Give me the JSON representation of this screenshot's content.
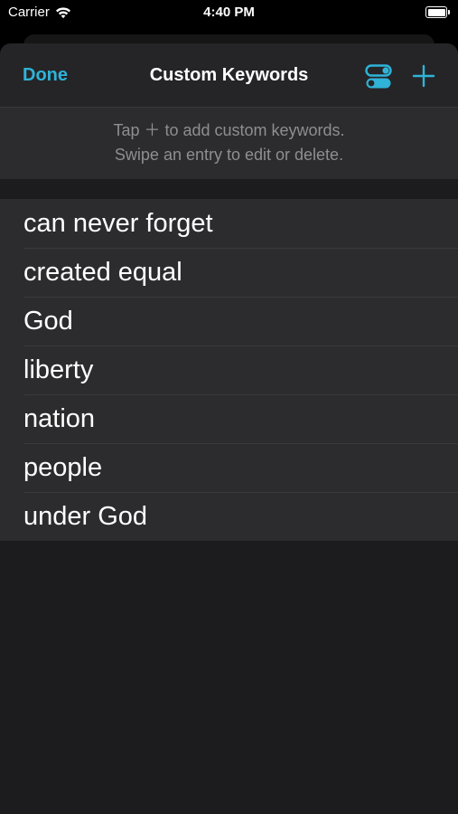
{
  "status_bar": {
    "carrier": "Carrier",
    "time": "4:40 PM"
  },
  "nav": {
    "done_label": "Done",
    "title": "Custom Keywords",
    "accent_color": "#2fb3d8"
  },
  "hint": {
    "line1": "Tap ＋ to add custom keywords.",
    "line2": "Swipe an entry to edit or delete."
  },
  "keywords": [
    "can never forget",
    "created equal",
    "God",
    "liberty",
    "nation",
    "people",
    "under God"
  ],
  "icons": {
    "wifi": "wifi-icon",
    "battery": "battery-icon",
    "toggle": "toggle-switches-icon",
    "add": "plus-icon"
  }
}
